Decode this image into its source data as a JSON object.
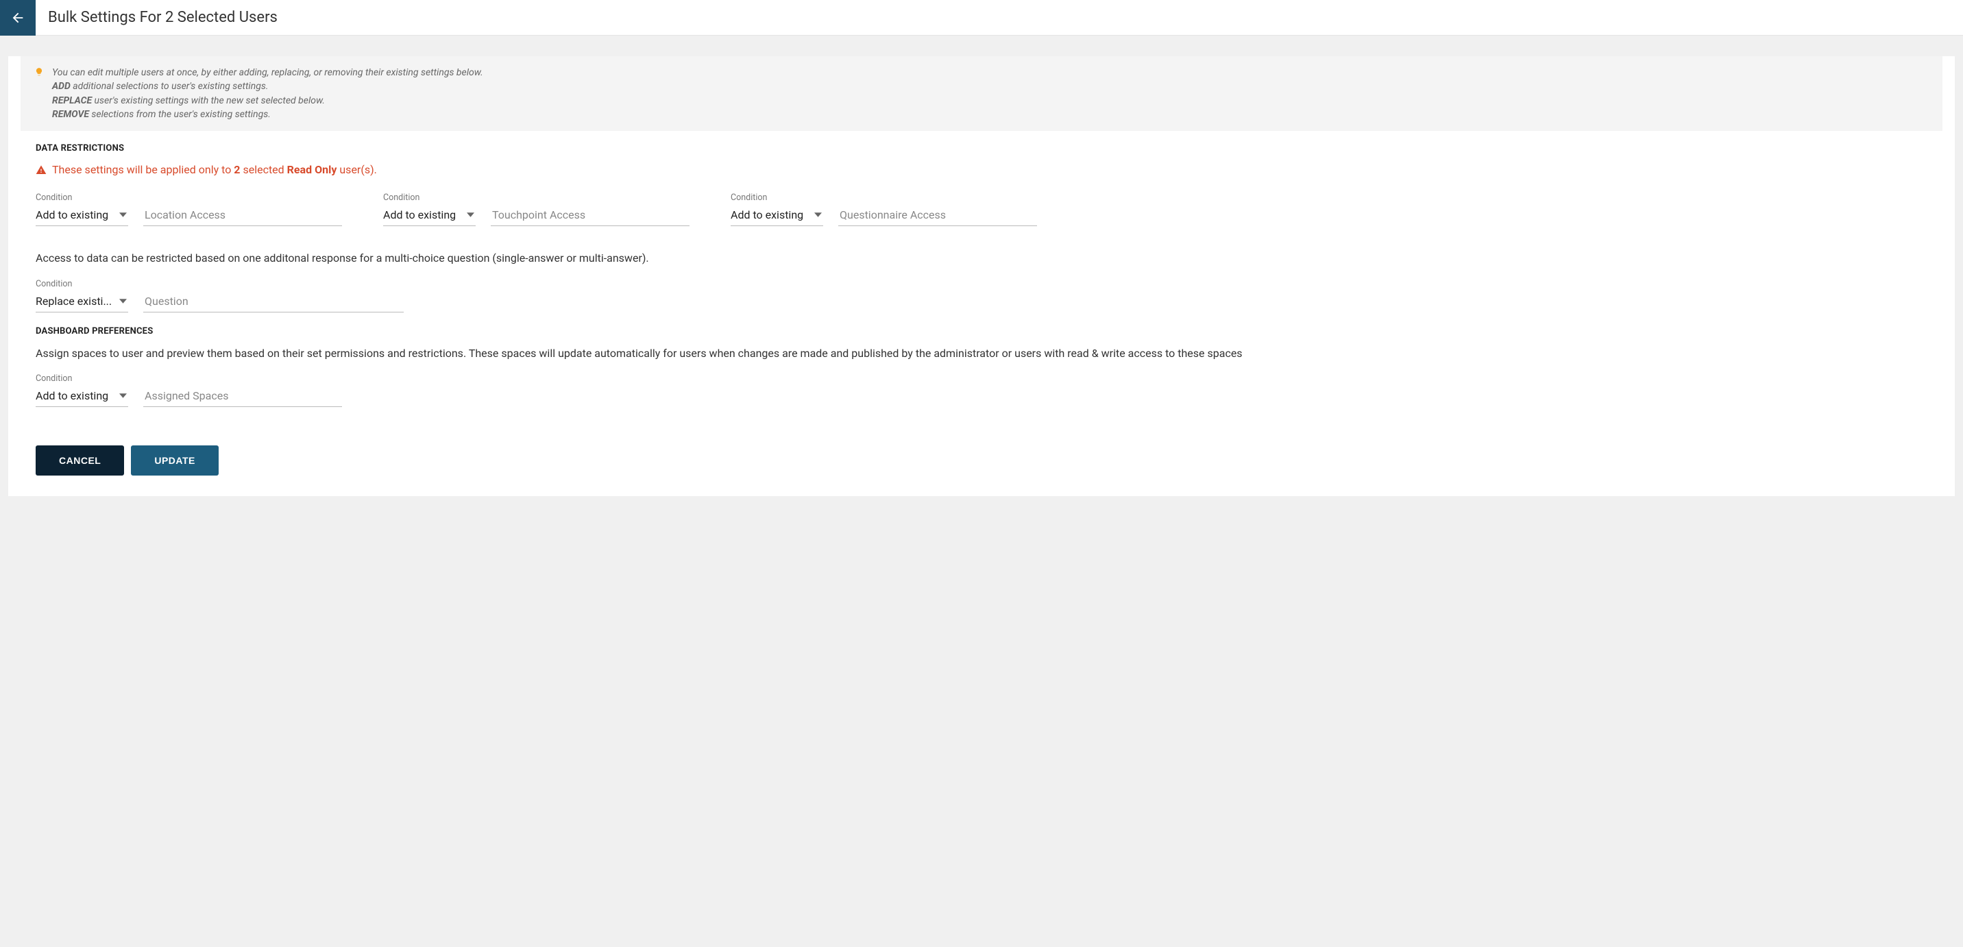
{
  "header": {
    "title": "Bulk Settings For 2 Selected Users"
  },
  "info": {
    "line1": "You can edit multiple users at once, by either adding, replacing, or removing their existing settings below.",
    "add_label": "ADD",
    "add_text": " additional selections to user's existing settings.",
    "replace_label": "REPLACE",
    "replace_text": " user's existing settings with the new set selected below.",
    "remove_label": "REMOVE",
    "remove_text": " selections from the user's existing settings."
  },
  "sections": {
    "data_restrictions": {
      "title": "DATA RESTRICTIONS",
      "warning_pre": "These settings will be applied only to ",
      "warning_count": "2",
      "warning_mid": " selected ",
      "warning_role": "Read Only",
      "warning_post": " user(s).",
      "condition_label": "Condition",
      "add_option": "Add to existing",
      "replace_option": "Replace existi...",
      "location_placeholder": "Location Access",
      "touchpoint_placeholder": "Touchpoint Access",
      "questionnaire_placeholder": "Questionnaire Access",
      "question_placeholder": "Question",
      "restrict_help": "Access to data can be restricted based on one additonal response for a multi-choice question (single-answer or multi-answer)."
    },
    "dashboard_prefs": {
      "title": "DASHBOARD PREFERENCES",
      "help": "Assign spaces to user and preview them based on their set permissions and restrictions. These spaces will update automatically for users when changes are made and published by the administrator or users with read & write access to these spaces",
      "condition_label": "Condition",
      "add_option": "Add to existing",
      "spaces_placeholder": "Assigned Spaces"
    }
  },
  "buttons": {
    "cancel": "CANCEL",
    "update": "UPDATE"
  }
}
